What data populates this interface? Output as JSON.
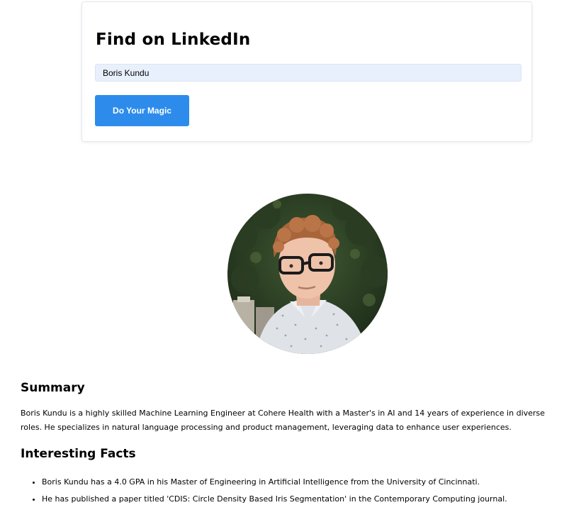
{
  "search_card": {
    "title": "Find on LinkedIn",
    "input_value": "Boris Kundu",
    "button_label": "Do Your Magic",
    "button_color": "#2d8ceb"
  },
  "profile": {
    "photo_icon": "profile-photo",
    "summary_heading": "Summary",
    "summary_text": "Boris Kundu is a highly skilled Machine Learning Engineer at Cohere Health with a Master's in AI and 14 years of experience in diverse roles. He specializes in natural language processing and product management, leveraging data to enhance user experiences.",
    "facts_heading": "Interesting Facts",
    "facts": [
      "Boris Kundu has a 4.0 GPA in his Master of Engineering in Artificial Intelligence from the University of Cincinnati.",
      "He has published a paper titled 'CDIS: Circle Density Based Iris Segmentation' in the Contemporary Computing journal."
    ]
  }
}
